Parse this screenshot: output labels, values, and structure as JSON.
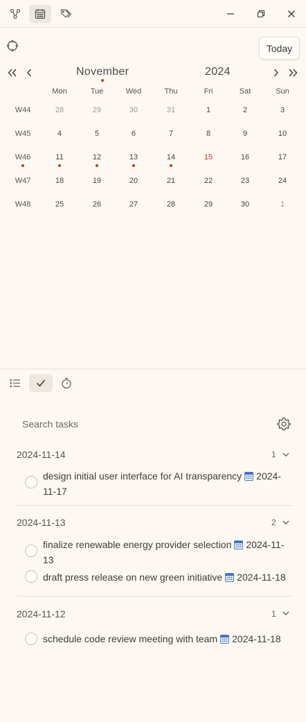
{
  "calendar": {
    "today_label": "Today",
    "month": "November",
    "year": "2024",
    "weekdays": [
      "Mon",
      "Tue",
      "Wed",
      "Thu",
      "Fri",
      "Sat",
      "Sun"
    ],
    "weeks": [
      {
        "label": "W44",
        "days": [
          "28",
          "29",
          "30",
          "31",
          "1",
          "2",
          "3"
        ]
      },
      {
        "label": "W45",
        "days": [
          "4",
          "5",
          "6",
          "7",
          "8",
          "9",
          "10"
        ]
      },
      {
        "label": "W46",
        "days": [
          "11",
          "12",
          "13",
          "14",
          "15",
          "16",
          "17"
        ]
      },
      {
        "label": "W47",
        "days": [
          "18",
          "19",
          "20",
          "21",
          "22",
          "23",
          "24"
        ]
      },
      {
        "label": "W48",
        "days": [
          "25",
          "26",
          "27",
          "28",
          "29",
          "30",
          "1"
        ]
      }
    ],
    "today": "15",
    "accent_color": "#c0392b"
  },
  "tasks": {
    "search_placeholder": "Search tasks",
    "groups": [
      {
        "date": "2024-11-14",
        "count": "1",
        "items": [
          {
            "line1": "design initial user interface for AI transparency",
            "due1": "2024-",
            "line2": "11-17"
          }
        ]
      },
      {
        "date": "2024-11-13",
        "count": "2",
        "items": [
          {
            "line1": "finalize renewable energy provider selection",
            "due1": "2024-11-",
            "line2": "13"
          },
          {
            "line1": "draft press release on new green initiative",
            "due1": "2024-11-18",
            "line2": ""
          }
        ]
      },
      {
        "date": "2024-11-12",
        "count": "1",
        "items": [
          {
            "line1": "schedule code review meeting with team",
            "due1": "2024-11-18",
            "line2": ""
          }
        ]
      }
    ]
  },
  "icons": {
    "top_tabs": [
      "graph-icon",
      "calendar-icon",
      "tags-icon"
    ],
    "window": [
      "minimize-icon",
      "restore-icon",
      "close-icon"
    ],
    "view_tabs": [
      "list-icon",
      "check-icon",
      "timer-icon"
    ]
  }
}
